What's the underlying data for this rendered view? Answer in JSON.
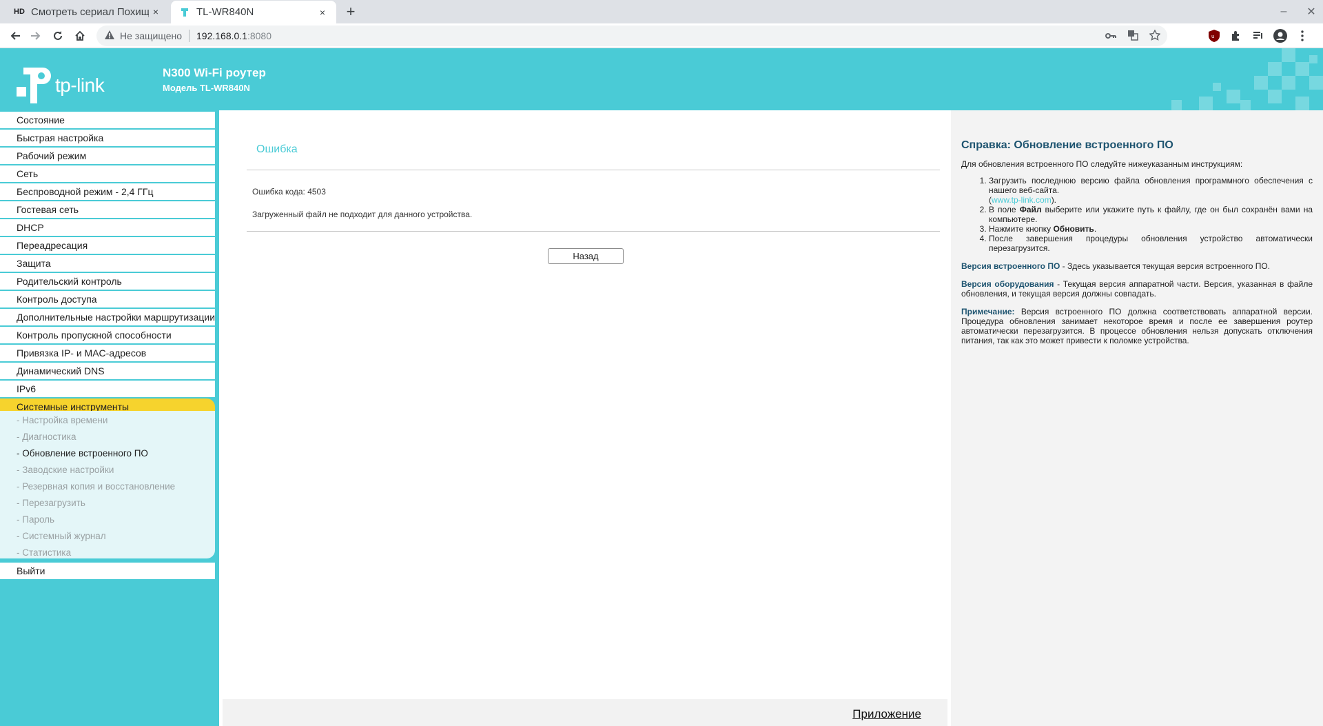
{
  "browser": {
    "tabs": [
      {
        "favicon": "HD",
        "title": "Смотреть сериал Похищ",
        "close": "×"
      },
      {
        "favicon": "tp-link-icon",
        "title": "TL-WR840N",
        "close": "×"
      }
    ],
    "new_tab": "+",
    "address": {
      "security": "Не защищено",
      "host": "192.168.0.1",
      "port": ":8080"
    }
  },
  "router": {
    "logo": "tp-link",
    "product_name": "N300 Wi-Fi роутер",
    "product_model": "Модель TL-WR840N",
    "menu": [
      "Состояние",
      "Быстрая настройка",
      "Рабочий режим",
      "Сеть",
      "Беспроводной режим - 2,4 ГГц",
      "Гостевая сеть",
      "DHCP",
      "Переадресация",
      "Защита",
      "Родительский контроль",
      "Контроль доступа",
      "Дополнительные настройки маршрутизации",
      "Контроль пропускной способности",
      "Привязка IP- и MAC-адресов",
      "Динамический DNS",
      "IPv6",
      "Системные инструменты"
    ],
    "submenu": [
      "- Настройка времени",
      "- Диагностика",
      "- Обновление встроенного ПО",
      "- Заводские настройки",
      "- Резервная копия и восстановление",
      "- Перезагрузить",
      "- Пароль",
      "- Системный журнал",
      "- Статистика"
    ],
    "logout": "Выйти",
    "main": {
      "title": "Ошибка",
      "error_code": "Ошибка кода: 4503",
      "error_message": "Загруженный файл не подходит для данного устройства.",
      "back_button": "Назад",
      "footer_link": "Приложение"
    },
    "help": {
      "title": "Справка: Обновление встроенного ПО",
      "intro": "Для обновления встроенного ПО следуйте нижеуказанным инструкциям:",
      "step1": "Загрузить последнюю версию файла обновления программного обеспечения с нашего веб-сайта.",
      "step1_link_open": "(",
      "step1_link": "www.tp-link.com",
      "step1_link_close": ").",
      "step2_a": "В поле ",
      "step2_bold": "Файл",
      "step2_b": " выберите или укажите путь к файлу, где он был сохранён вами на компьютере.",
      "step3_a": "Нажмите кнопку ",
      "step3_bold": "Обновить",
      "step3_b": ".",
      "step4": "После завершения процедуры обновления устройство автоматически перезагрузится.",
      "fw_term": "Версия встроенного ПО",
      "fw_text": " - Здесь указывается текущая версия встроенного ПО.",
      "hw_term": "Версия оборудования",
      "hw_text": " - Текущая версия аппаратной части. Версия, указанная в файле обновления, и текущая версия должны совпадать.",
      "note_term": "Примечание:",
      "note_text": " Версия встроенного ПО должна соответствовать аппаратной версии. Процедура обновления занимает некоторое время и после ее завершения роутер автоматически перезагрузится. В процессе обновления нельзя допускать отключения питания, так как это может привести к поломке устройства."
    }
  },
  "colors": {
    "brand": "#4acbd6",
    "active_menu": "#f6d32d",
    "help_heading": "#1e5470"
  }
}
